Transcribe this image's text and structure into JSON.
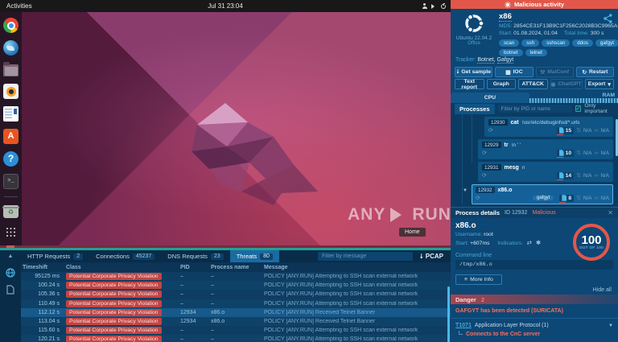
{
  "desktop": {
    "topbar": {
      "activities": "Activities",
      "clock": "Jul 31 23:04"
    },
    "watermark": {
      "brand_left": "ANY",
      "brand_right": "RUN",
      "home": "Home"
    },
    "dock_icons": [
      "chrome",
      "thunderbird",
      "files",
      "rhythmbox",
      "libreoffice-writer",
      "ubuntu-software",
      "help",
      "terminal",
      "trash",
      "app-grid"
    ]
  },
  "analysis": {
    "alert": "Malicious activity",
    "os": {
      "name": "Ubuntu 22.04.2",
      "edition": "Office"
    },
    "sample": {
      "name": "x86",
      "md5_label": "MD5:",
      "md5": "2854CE31F13B9C1F256C2028B3C9965A",
      "start_label": "Start:",
      "start": "01.08.2024, 01:04",
      "total_label": "Total time:",
      "total": "300 s",
      "tags": [
        "scan",
        "ssh",
        "sshscan",
        "ddos",
        "gafgyt",
        "botnet",
        "telnet"
      ]
    },
    "tracker": {
      "label": "Tracker:",
      "link1": "Botnet",
      "link2": "Gafgyt",
      "sep": ", "
    },
    "buttons": {
      "get_sample": "Get sample",
      "ioc": "IOC",
      "malconf": "MalConf",
      "restart": "Restart",
      "text_report": "Text report",
      "graph": "Graph",
      "attack": "ATT&CK",
      "chatgpt": "ChatGPT",
      "export": "Export"
    },
    "resources": {
      "cpu": "CPU",
      "ram": "RAM"
    },
    "processes": {
      "tab": "Processes",
      "filter_placeholder": "Filter by PID or name",
      "only_important": "Only important",
      "rows": [
        {
          "pid": "12930",
          "name": "cat",
          "args": "/usr/etc/debuginfod/*.urls",
          "events": "15",
          "na1": "N/A",
          "na2": "N/A",
          "tag": "",
          "selected": false,
          "width": "w1"
        },
        {
          "pid": "12929",
          "name": "tr",
          "args": "\\n ' '",
          "events": "10",
          "na1": "N/A",
          "na2": "N/A",
          "tag": "",
          "selected": false,
          "width": "w2"
        },
        {
          "pid": "12931",
          "name": "mesg",
          "args": "n",
          "events": "14",
          "na1": "N/A",
          "na2": "N/A",
          "tag": "",
          "selected": false,
          "width": "w2"
        },
        {
          "pid": "12932",
          "name": "x86.o",
          "args": "",
          "events": "8",
          "na1": "N/A",
          "na2": "N/A",
          "tag": "gafgyt",
          "selected": true,
          "width": "sel"
        }
      ]
    },
    "details": {
      "title": "Process details",
      "id": "ID 12932",
      "verdict": "Malicious",
      "process_name": "x86.o",
      "username_label": "Username:",
      "username": "root",
      "start_label": "Start:",
      "start": "+607ms",
      "indicators_label": "Indicators:",
      "score": "100",
      "score_caption": "OUT OF 100",
      "cmdline_label": "Command line",
      "cmdline": "/tmp/x86.o",
      "more_info": "More Info",
      "hide_all": "Hide all",
      "danger_label": "Danger",
      "danger_count": "2",
      "danger_item": "GAFGYT has been detected (SURICATA)",
      "technique_id": "T1071",
      "technique_name": "Application Layer Protocol (1)",
      "technique_sub": "Connects to the CnC server"
    },
    "colors": {
      "accent_red": "#e25749",
      "accent_teal": "#2aa9a4",
      "accent_blue": "#4ab8e8"
    }
  },
  "network_panel": {
    "tabs": [
      {
        "label": "HTTP Requests",
        "count": "2",
        "active": false
      },
      {
        "label": "Connections",
        "count": "45237",
        "active": false
      },
      {
        "label": "DNS Requests",
        "count": "23",
        "active": false
      },
      {
        "label": "Threats",
        "count": "80",
        "active": true
      }
    ],
    "filter_placeholder": "Filter by message",
    "pcap_label": "PCAP",
    "columns": [
      "Timeshift",
      "Class",
      "PID",
      "Process name",
      "Message"
    ],
    "rows": [
      {
        "time": "95125 ms",
        "class": "Potential Corporate Privacy Violation",
        "pid": "–",
        "pname": "–",
        "msg": "POLICY [ANY.RUN] Attempting to SSH scan external network",
        "selected": false
      },
      {
        "time": "100.24 s",
        "class": "Potential Corporate Privacy Violation",
        "pid": "–",
        "pname": "–",
        "msg": "POLICY [ANY.RUN] Attempting to SSH scan external network",
        "selected": false
      },
      {
        "time": "105.36 s",
        "class": "Potential Corporate Privacy Violation",
        "pid": "–",
        "pname": "–",
        "msg": "POLICY [ANY.RUN] Attempting to SSH scan external network",
        "selected": false
      },
      {
        "time": "110.49 s",
        "class": "Potential Corporate Privacy Violation",
        "pid": "–",
        "pname": "–",
        "msg": "POLICY [ANY.RUN] Attempting to SSH scan external network",
        "selected": false
      },
      {
        "time": "112.12 s",
        "class": "Potential Corporate Privacy Violation",
        "pid": "12934",
        "pname": "x86.o",
        "msg": "POLICY [ANY.RUN] Received Telnet Banner",
        "selected": true
      },
      {
        "time": "113.04 s",
        "class": "Potential Corporate Privacy Violation",
        "pid": "12934",
        "pname": "x86.o",
        "msg": "POLICY [ANY.RUN] Received Telnet Banner",
        "selected": false
      },
      {
        "time": "115.60 s",
        "class": "Potential Corporate Privacy Violation",
        "pid": "–",
        "pname": "–",
        "msg": "POLICY [ANY.RUN] Attempting to SSH scan external network",
        "selected": false
      },
      {
        "time": "120.21 s",
        "class": "Potential Corporate Privacy Violation",
        "pid": "–",
        "pname": "–",
        "msg": "POLICY [ANY.RUN] Attempting to SSH scan external network",
        "selected": false
      }
    ]
  }
}
